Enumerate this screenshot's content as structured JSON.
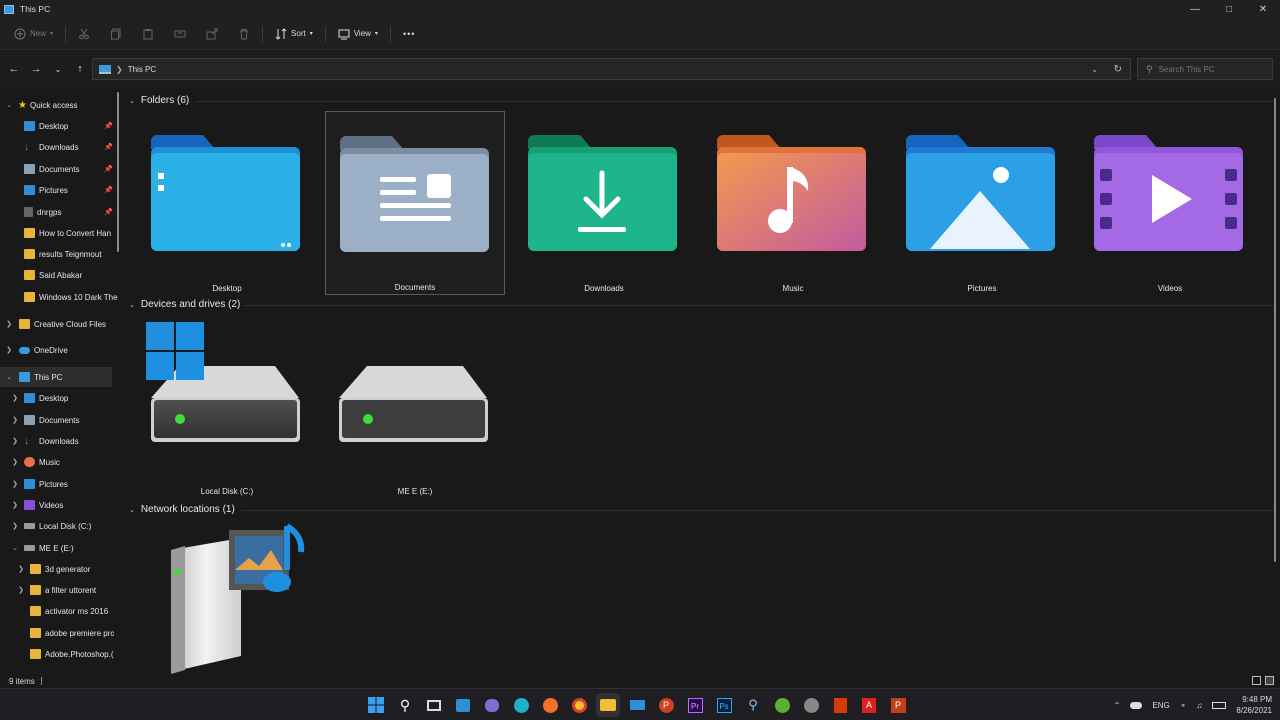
{
  "window": {
    "title": "This PC",
    "controls": [
      "minimize",
      "maximize",
      "close"
    ]
  },
  "toolbar": {
    "new_label": "New",
    "sort_label": "Sort",
    "view_label": "View",
    "more_label": "•••"
  },
  "address": {
    "path": "This PC",
    "search_placeholder": "Search This PC"
  },
  "sidebar": {
    "quick_access": {
      "label": "Quick access",
      "items": [
        {
          "label": "Desktop",
          "icon": "desktop-icon",
          "pinned": true
        },
        {
          "label": "Downloads",
          "icon": "downloads-icon",
          "pinned": true
        },
        {
          "label": "Documents",
          "icon": "documents-icon",
          "pinned": true
        },
        {
          "label": "Pictures",
          "icon": "pictures-icon",
          "pinned": true
        },
        {
          "label": "dnrgps",
          "icon": "folder-icon",
          "pinned": true
        },
        {
          "label": "How to Convert Han",
          "icon": "folder-icon",
          "pinned": false
        },
        {
          "label": "results Teignmout",
          "icon": "folder-icon",
          "pinned": false
        },
        {
          "label": "Said Abakar",
          "icon": "folder-icon",
          "pinned": false
        },
        {
          "label": "Windows 10 Dark The",
          "icon": "folder-icon",
          "pinned": false
        }
      ]
    },
    "creative_cloud": "Creative Cloud Files",
    "onedrive": "OneDrive",
    "this_pc": {
      "label": "This PC",
      "items": [
        {
          "label": "Desktop",
          "icon": "desktop-icon"
        },
        {
          "label": "Documents",
          "icon": "documents-icon"
        },
        {
          "label": "Downloads",
          "icon": "downloads-icon"
        },
        {
          "label": "Music",
          "icon": "music-icon"
        },
        {
          "label": "Pictures",
          "icon": "pictures-icon"
        },
        {
          "label": "Videos",
          "icon": "videos-icon"
        },
        {
          "label": "Local Disk (C:)",
          "icon": "drive-icon"
        },
        {
          "label": "ME E (E:)",
          "icon": "drive-icon"
        }
      ]
    },
    "drive_e_children": [
      {
        "label": "3d generator",
        "expandable": true
      },
      {
        "label": "a filter uttorent",
        "expandable": true
      },
      {
        "label": "activator ms 2016",
        "expandable": false
      },
      {
        "label": "adobe premiere prc",
        "expandable": false
      },
      {
        "label": "Adobe.Photoshop.(",
        "expandable": false
      }
    ]
  },
  "content": {
    "folders_header": "Folders (6)",
    "folders": [
      "Desktop",
      "Documents",
      "Downloads",
      "Music",
      "Pictures",
      "Videos"
    ],
    "selected_folder": "Documents",
    "drives_header": "Devices and drives (2)",
    "drives": [
      "Local Disk (C:)",
      "ME E (E:)"
    ],
    "network_header": "Network locations (1)"
  },
  "status": {
    "items_count": "9 items"
  },
  "taskbar": {
    "language": "ENG",
    "time": "9:48 PM",
    "date": "8/26/2021"
  },
  "colors": {
    "background": "#191919",
    "chrome": "#202020",
    "accent": "#3a9ae0"
  }
}
